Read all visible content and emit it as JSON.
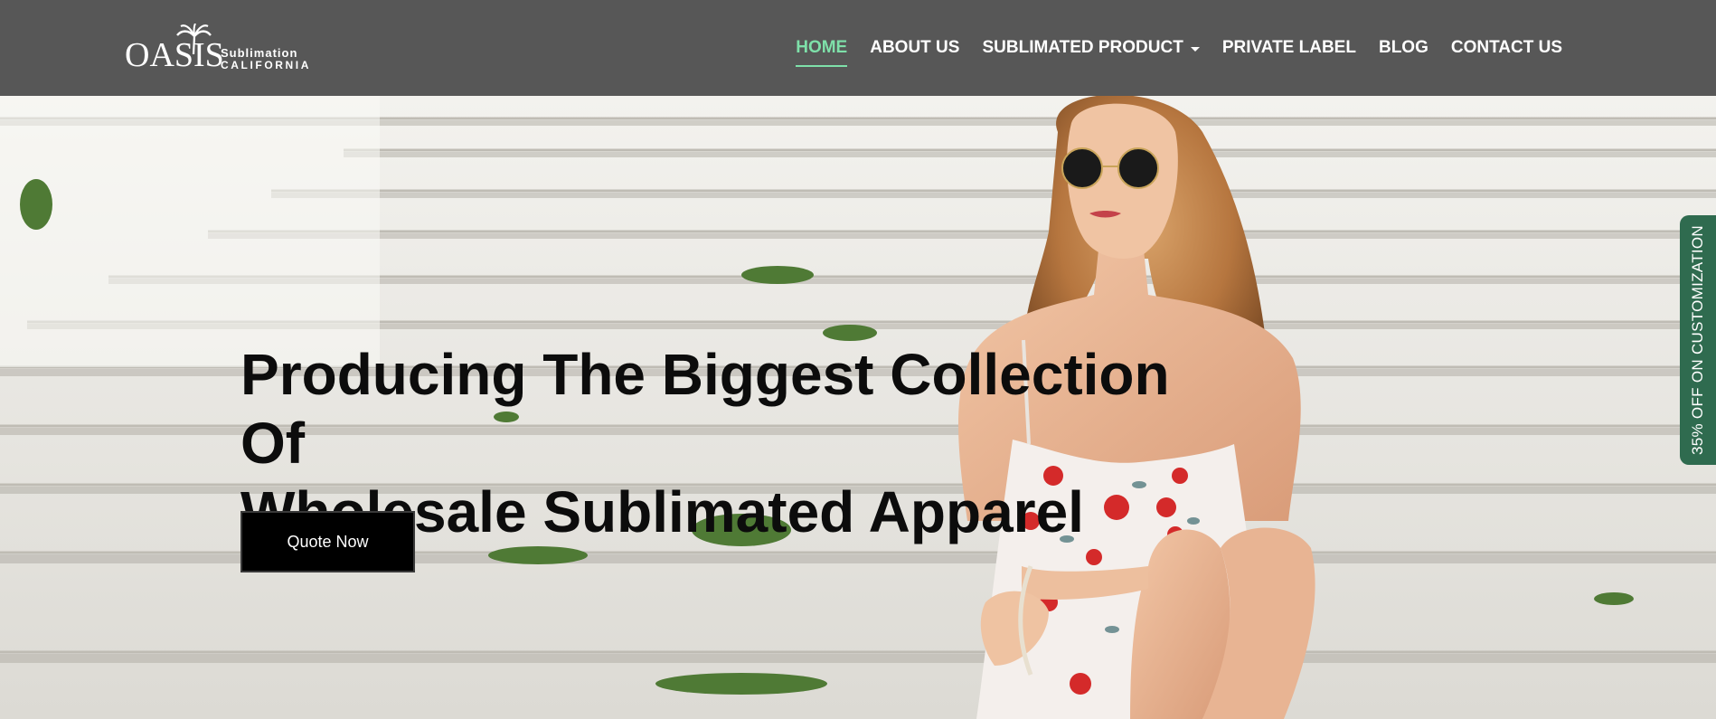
{
  "logo": {
    "main": "OASIS",
    "line1": "Sublimation",
    "line2": "CALIFORNIA"
  },
  "nav": {
    "items": [
      {
        "label": "HOME",
        "active": true
      },
      {
        "label": "ABOUT US"
      },
      {
        "label": "SUBLIMATED PRODUCT",
        "dropdown": true
      },
      {
        "label": "PRIVATE LABEL"
      },
      {
        "label": "BLOG"
      },
      {
        "label": "CONTACT US"
      }
    ]
  },
  "hero": {
    "headline_line1": "Producing The Biggest Collection Of",
    "headline_line2": "Wholesale Sublimated Apparel",
    "cta_label": "Quote Now"
  },
  "side_tab": {
    "label": "35% OFF ON CUSTOMIZATION"
  },
  "colors": {
    "header_bg": "#575757",
    "nav_active": "#7ee0a9",
    "side_tab_bg": "#2f6b4f",
    "cta_bg": "#000000"
  }
}
